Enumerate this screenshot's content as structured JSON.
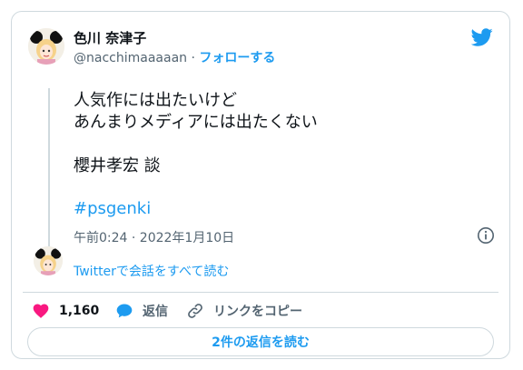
{
  "author": {
    "display_name": "色川 奈津子",
    "handle": "@nacchimaaaaan",
    "separator": "·",
    "follow_label": "フォローする"
  },
  "tweet": {
    "text": "人気作には出たいけど\nあんまりメディアには出たくない\n\n櫻井孝宏 談",
    "hashtag": "#psgenki",
    "timestamp": "午前0:24 · 2022年1月10日"
  },
  "conversation": {
    "link_label": "Twitterで会話をすべて読む"
  },
  "actions": {
    "like_count": "1,160",
    "reply_label": "返信",
    "copy_link_label": "リンクをコピー"
  },
  "read_replies_label": "2件の返信を読む",
  "icons": {
    "brand": "twitter-bird-icon",
    "info": "info-icon",
    "like": "heart-icon",
    "reply": "speech-bubble-icon",
    "copy": "link-icon"
  },
  "colors": {
    "accent": "#1d9bf0",
    "like": "#f91880",
    "text": "#0f1419",
    "muted": "#536471",
    "border": "#cfd9de"
  }
}
